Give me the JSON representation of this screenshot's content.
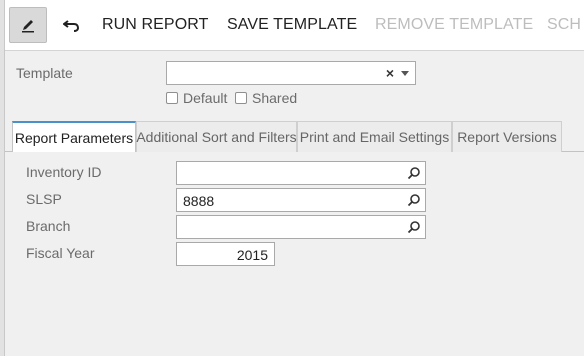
{
  "toolbar": {
    "edit_icon": "pencil-icon",
    "undo_icon": "undo-icon",
    "run_report": "RUN REPORT",
    "save_template": "SAVE TEMPLATE",
    "remove_template": "REMOVE TEMPLATE",
    "schedule_partial": "SCH"
  },
  "template": {
    "label": "Template",
    "value": "",
    "default_label": "Default",
    "shared_label": "Shared"
  },
  "tabs": [
    {
      "label": "Report Parameters",
      "active": true
    },
    {
      "label": "Additional Sort and Filters",
      "active": false
    },
    {
      "label": "Print and Email Settings",
      "active": false
    },
    {
      "label": "Report Versions",
      "active": false
    }
  ],
  "params": {
    "inventory_id": {
      "label": "Inventory ID",
      "value": ""
    },
    "slsp": {
      "label": "SLSP",
      "value": "8888"
    },
    "branch": {
      "label": "Branch",
      "value": ""
    },
    "fiscal_year": {
      "label": "Fiscal Year",
      "value": "2015"
    }
  },
  "colors": {
    "active_tab_accent": "#4a90c9",
    "disabled_text": "#bdbdbd"
  }
}
